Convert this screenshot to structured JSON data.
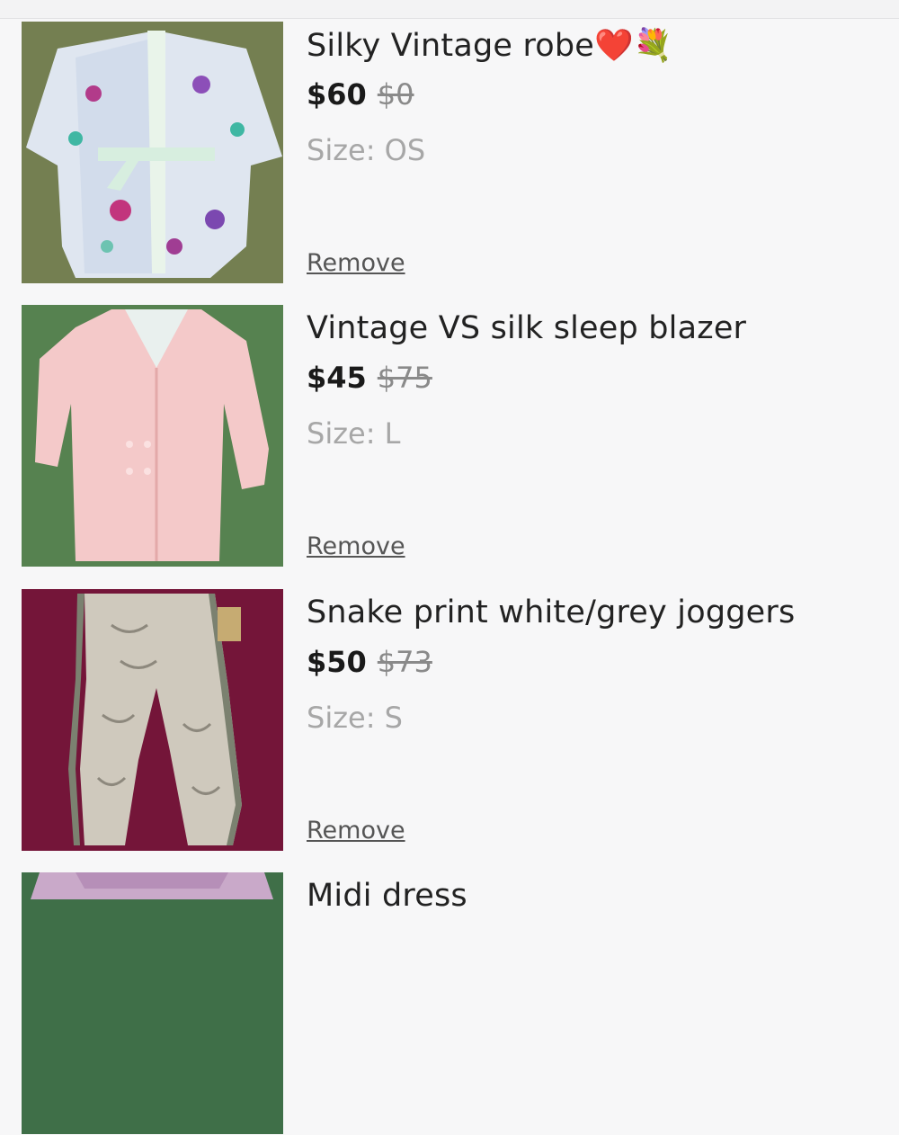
{
  "cart": {
    "items": [
      {
        "title": "Silky Vintage robe❤️💐",
        "price": "$60",
        "original_price": "$0",
        "size_label": "Size:",
        "size": "OS",
        "remove_label": "Remove",
        "image_desc": "floral robe on green backdrop"
      },
      {
        "title": "Vintage VS silk sleep blazer",
        "price": "$45",
        "original_price": "$75",
        "size_label": "Size:",
        "size": "L",
        "remove_label": "Remove",
        "image_desc": "pink blazer on green backdrop"
      },
      {
        "title": "Snake print white/grey joggers",
        "price": "$50",
        "original_price": "$73",
        "size_label": "Size:",
        "size": "S",
        "remove_label": "Remove",
        "image_desc": "snake print joggers on magenta backdrop"
      },
      {
        "title": "Midi dress",
        "price": "",
        "original_price": "",
        "size_label": "",
        "size": "",
        "remove_label": "",
        "image_desc": "dress partially visible"
      }
    ]
  },
  "colors": {
    "background": "#f7f7f8",
    "text": "#222222",
    "muted": "#a7a7a7",
    "strike": "#8a8a8a"
  }
}
